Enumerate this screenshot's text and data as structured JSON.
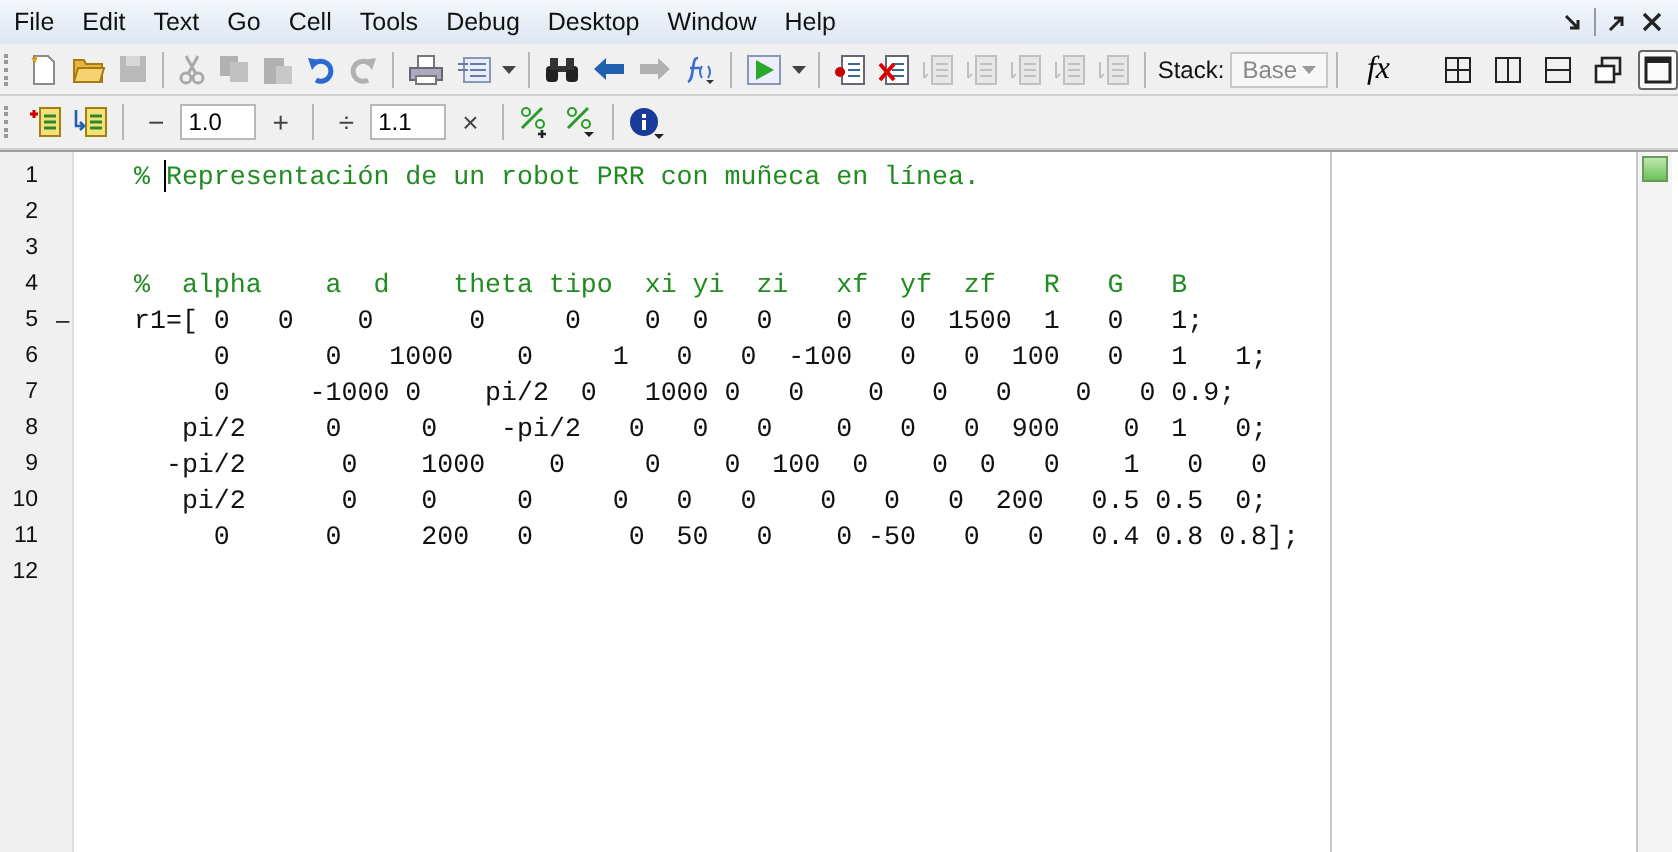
{
  "menu": [
    {
      "label": "File"
    },
    {
      "label": "Edit"
    },
    {
      "label": "Text"
    },
    {
      "label": "Go"
    },
    {
      "label": "Cell"
    },
    {
      "label": "Tools"
    },
    {
      "label": "Debug"
    },
    {
      "label": "Desktop"
    },
    {
      "label": "Window"
    },
    {
      "label": "Help"
    }
  ],
  "window_controls": [
    {
      "kind": "undock"
    },
    {
      "kind": "dock"
    },
    {
      "kind": "close"
    }
  ],
  "toolbar": [
    {
      "kind": "new",
      "disabled": false
    },
    {
      "kind": "open",
      "disabled": false
    },
    {
      "kind": "save",
      "disabled": true
    },
    {
      "kind": "sep"
    },
    {
      "kind": "cut",
      "disabled": true
    },
    {
      "kind": "copy",
      "disabled": true
    },
    {
      "kind": "paste",
      "disabled": true
    },
    {
      "kind": "undo",
      "disabled": false
    },
    {
      "kind": "redo",
      "disabled": true
    },
    {
      "kind": "sep"
    },
    {
      "kind": "print",
      "disabled": false
    },
    {
      "kind": "pagesetup",
      "disabled": false
    },
    {
      "kind": "caret",
      "disabled": false
    },
    {
      "kind": "sep"
    },
    {
      "kind": "find",
      "disabled": false
    },
    {
      "kind": "back",
      "disabled": false
    },
    {
      "kind": "forward",
      "disabled": true
    },
    {
      "kind": "func",
      "disabled": false
    },
    {
      "kind": "sep"
    },
    {
      "kind": "run",
      "disabled": false
    },
    {
      "kind": "caret",
      "disabled": false
    },
    {
      "kind": "sep"
    },
    {
      "kind": "bpset",
      "disabled": false
    },
    {
      "kind": "bpclear",
      "disabled": false
    },
    {
      "kind": "step",
      "disabled": true
    },
    {
      "kind": "stepin",
      "disabled": true
    },
    {
      "kind": "stepout",
      "disabled": true
    },
    {
      "kind": "continue",
      "disabled": true
    },
    {
      "kind": "exit",
      "disabled": true
    },
    {
      "kind": "sep"
    }
  ],
  "stack": {
    "label": "Stack:",
    "value": "Base",
    "disabled": true
  },
  "fx": "fx",
  "layout_buttons": [
    {
      "kind": "tile",
      "selected": false
    },
    {
      "kind": "cols",
      "selected": false
    },
    {
      "kind": "rows",
      "selected": false
    },
    {
      "kind": "float",
      "selected": false
    },
    {
      "kind": "max",
      "selected": true
    }
  ],
  "cell_toolbar": [
    {
      "kind": "cellinsert"
    },
    {
      "kind": "cellnext"
    },
    {
      "kind": "sep"
    },
    {
      "kind": "glyph",
      "text": "−"
    },
    {
      "kind": "field",
      "value": "1.0"
    },
    {
      "kind": "glyph",
      "text": "+"
    },
    {
      "kind": "sep"
    },
    {
      "kind": "glyph",
      "text": "÷"
    },
    {
      "kind": "field",
      "value": "1.1"
    },
    {
      "kind": "glyph",
      "text": "×"
    },
    {
      "kind": "sep"
    },
    {
      "kind": "pctplus"
    },
    {
      "kind": "pctcaret"
    },
    {
      "kind": "sep"
    },
    {
      "kind": "info"
    }
  ],
  "editor": {
    "lines": [
      {
        "number": "1",
        "kind": "comment",
        "text": "% Representación de un robot PRR con muñeca en línea.",
        "cursor": true
      },
      {
        "number": "2"
      },
      {
        "number": "3"
      },
      {
        "number": "4",
        "kind": "comment",
        "text": "%  alpha    a  d    theta tipo  xi yi  zi   xf  yf  zf   R   G   B"
      },
      {
        "number": "5",
        "kind": "code",
        "marker": "–",
        "text": "r1=[ 0   0    0      0     0    0  0   0    0   0  1500  1   0   1;"
      },
      {
        "number": "6",
        "kind": "code",
        "text": "     0      0   1000    0     1   0   0  -100   0   0  100   0   1   1;"
      },
      {
        "number": "7",
        "kind": "code",
        "text": "     0     -1000 0    pi/2  0   1000 0   0    0   0   0    0   0 0.9;"
      },
      {
        "number": "8",
        "kind": "code",
        "text": "   pi/2     0     0    -pi/2   0   0   0    0   0   0  900    0  1   0;"
      },
      {
        "number": "9",
        "kind": "code",
        "text": "  -pi/2      0    1000    0     0    0  100  0    0  0   0    1   0   0"
      },
      {
        "number": "10",
        "kind": "code",
        "text": "   pi/2      0    0     0     0   0   0    0   0   0  200   0.5 0.5  0;"
      },
      {
        "number": "11",
        "kind": "code",
        "text": "     0      0     200   0      0  50   0    0 -50   0   0   0.4 0.8 0.8];"
      },
      {
        "number": "12"
      }
    ]
  }
}
